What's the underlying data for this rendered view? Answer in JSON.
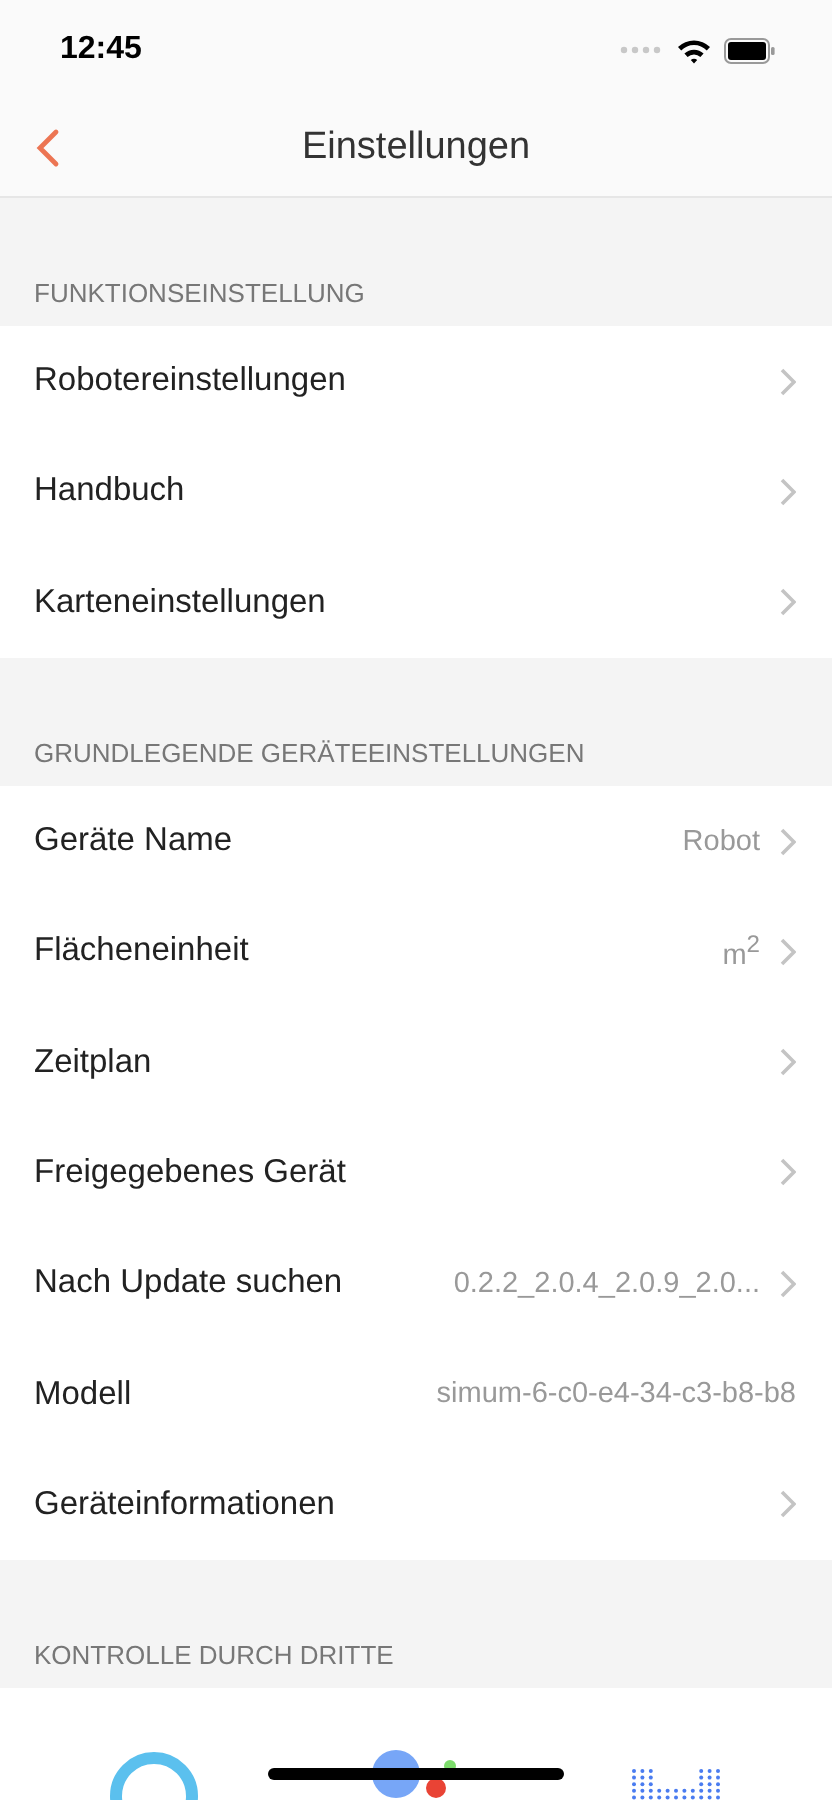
{
  "status_bar": {
    "time": "12:45"
  },
  "nav": {
    "title": "Einstellungen"
  },
  "sections": [
    {
      "header": "FUNKTIONSEINSTELLUNG",
      "rows": [
        {
          "label": "Robotereinstellungen",
          "chevron": true
        },
        {
          "label": "Handbuch",
          "chevron": true
        },
        {
          "label": "Karteneinstellungen",
          "chevron": true
        }
      ]
    },
    {
      "header": "GRUNDLEGENDE GERÄTEEINSTELLUNGEN",
      "rows": [
        {
          "label": "Geräte Name",
          "value": "Robot",
          "chevron": true
        },
        {
          "label": "Flächeneinheit",
          "value": "m$^{2}$",
          "chevron": true
        },
        {
          "label": "Zeitplan",
          "chevron": true
        },
        {
          "label": "Freigegebenes Gerät",
          "chevron": true
        },
        {
          "label": "Nach Update suchen",
          "value": "0.2.2_2.0.4_2.0.9_2.0...",
          "chevron": true
        },
        {
          "label": "Modell",
          "value": "simum-6-c0-e4-34-c3-b8-b8",
          "chevron": false
        },
        {
          "label": "Geräteinformationen",
          "chevron": true
        }
      ]
    },
    {
      "header": "KONTROLLE DURCH DRITTE"
    }
  ]
}
